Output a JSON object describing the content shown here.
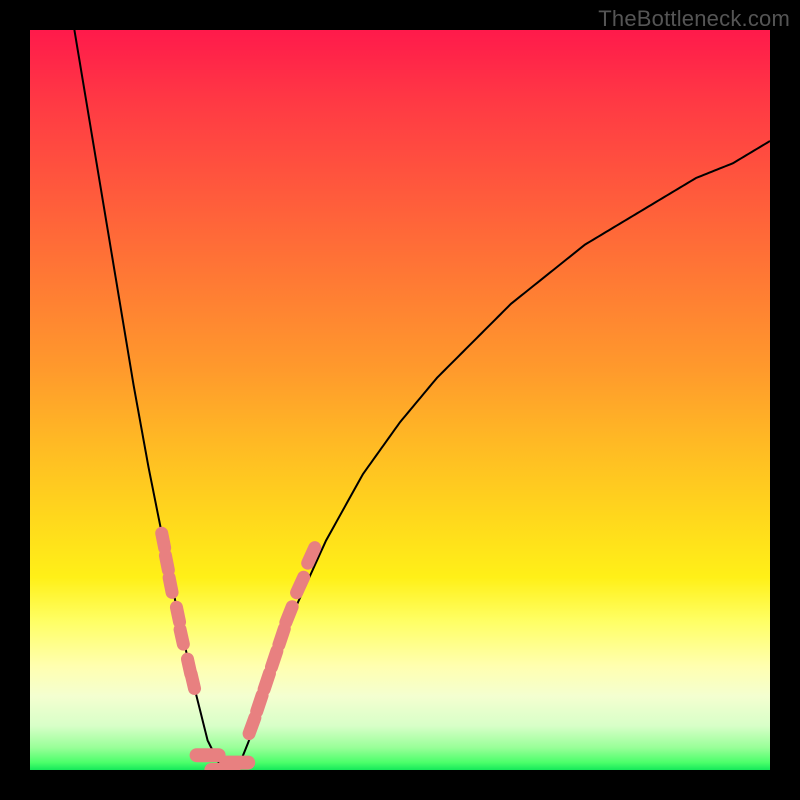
{
  "watermark": "TheBottleneck.com",
  "colors": {
    "marker": "#e88080",
    "line": "#000000",
    "gradient_top": "#ff1a4b",
    "gradient_bottom": "#15e85a"
  },
  "chart_data": {
    "type": "line",
    "title": "",
    "xlabel": "",
    "ylabel": "",
    "xlim": [
      0,
      100
    ],
    "ylim": [
      0,
      100
    ],
    "note": "V-shaped bottleneck curve; y≈0 near x≈24–28; steep rise on the left toward y≈100 at x≈6; gentler rise on the right reaching y≈85 at x≈100. Values estimated from unlabeled axes.",
    "series": [
      {
        "name": "bottleneck-curve",
        "x": [
          6,
          8,
          10,
          12,
          14,
          16,
          18,
          20,
          22,
          24,
          26,
          28,
          30,
          32,
          35,
          40,
          45,
          50,
          55,
          60,
          65,
          70,
          75,
          80,
          85,
          90,
          95,
          100
        ],
        "y": [
          100,
          88,
          76,
          64,
          52,
          41,
          31,
          21,
          12,
          4,
          0,
          0,
          5,
          11,
          20,
          31,
          40,
          47,
          53,
          58,
          63,
          67,
          71,
          74,
          77,
          80,
          82,
          85
        ]
      }
    ],
    "markers": {
      "note": "Salmon rounded markers clustered on both arms near the valley and at the valley floor.",
      "left_arm": [
        {
          "x": 18,
          "y": 31
        },
        {
          "x": 18.5,
          "y": 28
        },
        {
          "x": 19,
          "y": 25
        },
        {
          "x": 20,
          "y": 21
        },
        {
          "x": 20.5,
          "y": 18
        },
        {
          "x": 21.5,
          "y": 14
        },
        {
          "x": 22,
          "y": 12
        }
      ],
      "valley": [
        {
          "x": 24,
          "y": 2
        },
        {
          "x": 26,
          "y": 0
        },
        {
          "x": 28,
          "y": 1
        }
      ],
      "right_arm": [
        {
          "x": 30,
          "y": 6
        },
        {
          "x": 31,
          "y": 9
        },
        {
          "x": 32,
          "y": 12
        },
        {
          "x": 33,
          "y": 15
        },
        {
          "x": 34,
          "y": 18
        },
        {
          "x": 35,
          "y": 21
        },
        {
          "x": 36.5,
          "y": 25
        },
        {
          "x": 38,
          "y": 29
        }
      ]
    }
  }
}
